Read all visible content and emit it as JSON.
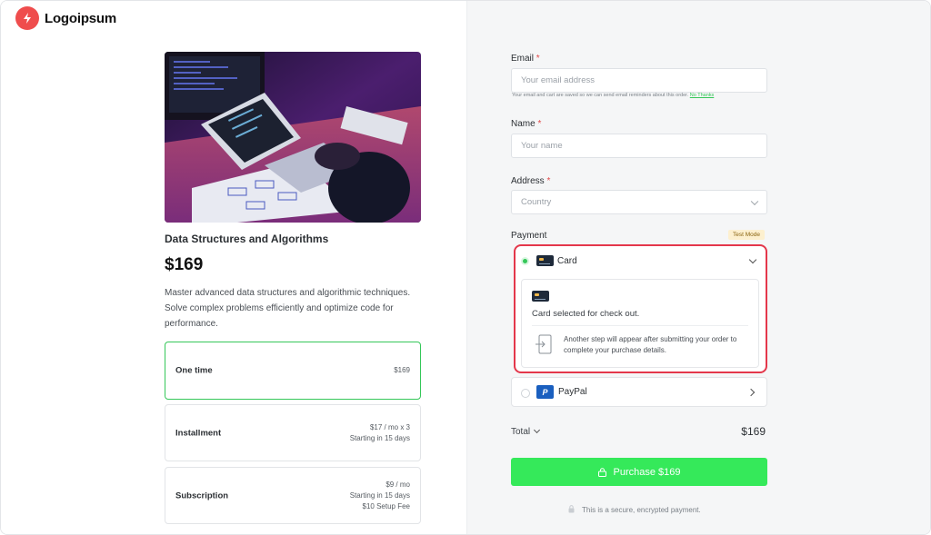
{
  "brand": {
    "name": "Logoipsum"
  },
  "product": {
    "title": "Data Structures and Algorithms",
    "price": "$169",
    "description": "Master advanced data structures and algorithmic techniques. Solve complex problems efficiently and optimize code for performance."
  },
  "plans": [
    {
      "label": "One time",
      "info": [
        "$169"
      ],
      "selected": true
    },
    {
      "label": "Installment",
      "info": [
        "$17 / mo x 3",
        "Starting in 15 days"
      ],
      "selected": false
    },
    {
      "label": "Subscription",
      "info": [
        "$9 / mo",
        "Starting in 15 days",
        "$10 Setup Fee"
      ],
      "selected": false
    }
  ],
  "form": {
    "email": {
      "label": "Email",
      "required": "*",
      "placeholder": "Your email address"
    },
    "email_hint": "Your email and cart are saved so we can send email reminders about this order.",
    "email_hint_link": "No Thanks",
    "name": {
      "label": "Name",
      "required": "*",
      "placeholder": "Your name"
    },
    "address": {
      "label": "Address",
      "required": "*",
      "placeholder": "Country"
    }
  },
  "payment": {
    "label": "Payment",
    "badge": "Test Mode",
    "card": {
      "label": "Card",
      "selected_text": "Card selected for check out.",
      "step_text": "Another step will appear after submitting your order to complete your purchase details."
    },
    "paypal": {
      "label": "PayPal"
    }
  },
  "total": {
    "label": "Total",
    "value": "$169"
  },
  "purchase_button": "Purchase $169",
  "secure_text": "This is a secure, encrypted payment.",
  "colors": {
    "accent": "#35e95a",
    "selected_border": "#35c759",
    "highlight": "#e4374b",
    "brand": "#ef4d4d"
  }
}
